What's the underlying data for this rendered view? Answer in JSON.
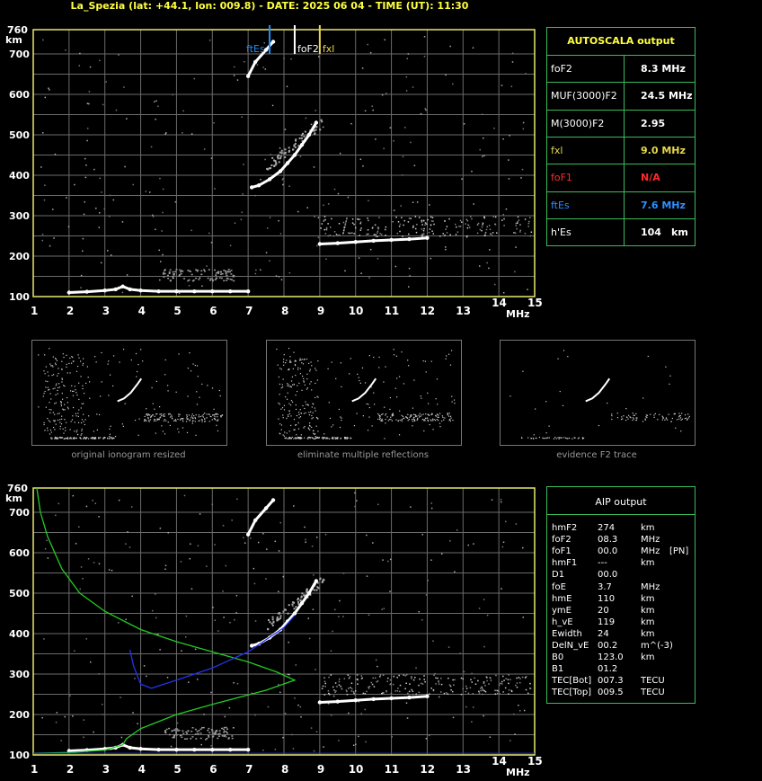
{
  "header": {
    "title": "La_Spezia (lat: +44.1, lon: 009.8) - DATE: 2025 06 04 - TIME (UT): 11:30"
  },
  "axis": {
    "y_unit": "km",
    "x_unit": "MHz",
    "y_top_label": "760",
    "y_ticks": [
      "700",
      "600",
      "500",
      "400",
      "300",
      "200",
      "100"
    ],
    "x_ticks": [
      "1",
      "2",
      "3",
      "4",
      "5",
      "6",
      "7",
      "8",
      "9",
      "10",
      "11",
      "12",
      "13",
      "14",
      "15"
    ]
  },
  "markers": {
    "ftes": {
      "label": "ftEs",
      "color": "#1e90ff",
      "freq": 7.6
    },
    "fof2": {
      "label": "foF2",
      "color": "#ffffff",
      "freq": 8.3
    },
    "fxl": {
      "label": "fxl",
      "color": "#e8d84a",
      "freq": 9.0
    }
  },
  "autoscala": {
    "title": "AUTOSCALA output",
    "rows": [
      {
        "key": "foF2",
        "value": "8.3 MHz",
        "color": "#ffffff"
      },
      {
        "key": "MUF(3000)F2",
        "value": "24.5 MHz",
        "color": "#ffffff"
      },
      {
        "key": "M(3000)F2",
        "value": "2.95",
        "color": "#ffffff"
      },
      {
        "key": "fxl",
        "value": "9.0 MHz",
        "color": "#e8d84a"
      },
      {
        "key": "foF1",
        "value": "N/A",
        "color": "#ff2a2a"
      },
      {
        "key": "ftEs",
        "value": "7.6 MHz",
        "color": "#2f8fff"
      },
      {
        "key": "h'Es",
        "value": "104",
        "unit": "km",
        "color": "#ffffff"
      }
    ]
  },
  "thumbnails": {
    "captions": [
      "original ionogram resized",
      "eliminate multiple reflections",
      "evidence F2 trace"
    ]
  },
  "aip": {
    "title": "AIP output",
    "rows": [
      {
        "k": "hmF2",
        "v": "274",
        "u": "km"
      },
      {
        "k": "foF2",
        "v": "08.3",
        "u": "MHz"
      },
      {
        "k": "foF1",
        "v": "00.0",
        "u": "MHz",
        "x": "[PN]"
      },
      {
        "k": "hmF1",
        "v": "---",
        "u": "km"
      },
      {
        "k": "D1",
        "v": "00.0",
        "u": ""
      },
      {
        "k": "foE",
        "v": "3.7",
        "u": "MHz"
      },
      {
        "k": "hmE",
        "v": "110",
        "u": "km"
      },
      {
        "k": "ymE",
        "v": "20",
        "u": "km"
      },
      {
        "k": "h_vE",
        "v": "119",
        "u": "km"
      },
      {
        "k": "Ewidth",
        "v": "24",
        "u": "km"
      },
      {
        "k": "DelN_vE",
        "v": "00.2",
        "u": "m^(-3)"
      },
      {
        "k": "B0",
        "v": "123.0",
        "u": "km"
      },
      {
        "k": "B1",
        "v": "01.2",
        "u": ""
      },
      {
        "k": "TEC[Bot]",
        "v": "007.3",
        "u": "TECU"
      },
      {
        "k": "TEC[Top]",
        "v": "009.5",
        "u": "TECU"
      }
    ]
  },
  "colors": {
    "grid": "#6b6b6b",
    "frame": "#e8e870",
    "table_border": "#3cbb5a",
    "title": "#ffff40"
  },
  "chart_data": [
    {
      "type": "scatter",
      "xlabel": "MHz",
      "ylabel": "km",
      "xlim": [
        1,
        15
      ],
      "ylim": [
        100,
        760
      ],
      "grid": true,
      "series": [
        {
          "name": "",
          "points": [
            [
              2.0,
              110
            ],
            [
              2.5,
              112
            ],
            [
              3.0,
              115
            ],
            [
              3.3,
              118
            ],
            [
              3.5,
              125
            ],
            [
              3.7,
              118
            ],
            [
              4.0,
              115
            ],
            [
              4.5,
              113
            ],
            [
              5.0,
              113
            ],
            [
              5.5,
              113
            ],
            [
              6.0,
              113
            ],
            [
              6.5,
              113
            ],
            [
              7.0,
              113
            ]
          ]
        },
        {
          "name": "",
          "points": [
            [
              7.1,
              370
            ],
            [
              7.3,
              375
            ],
            [
              7.6,
              390
            ],
            [
              7.9,
              410
            ],
            [
              8.1,
              430
            ],
            [
              8.3,
              450
            ],
            [
              8.5,
              475
            ],
            [
              8.7,
              500
            ],
            [
              8.9,
              530
            ]
          ]
        },
        {
          "name": "",
          "points": [
            [
              9.0,
              230
            ],
            [
              9.5,
              232
            ],
            [
              10.0,
              235
            ],
            [
              10.5,
              238
            ],
            [
              11.0,
              240
            ],
            [
              11.5,
              242
            ],
            [
              12.0,
              245
            ]
          ]
        },
        {
          "name": "",
          "points": [
            [
              7.0,
              645
            ],
            [
              7.2,
              680
            ],
            [
              7.5,
              710
            ],
            [
              7.7,
              730
            ]
          ]
        }
      ]
    },
    {
      "type": "line",
      "xlabel": "MHz",
      "ylabel": "km",
      "xlim": [
        1,
        15
      ],
      "ylim": [
        100,
        760
      ],
      "grid": true,
      "series": [
        {
          "name": "",
          "color": "#22cc22",
          "points": [
            [
              1.1,
              760
            ],
            [
              1.2,
              700
            ],
            [
              1.4,
              640
            ],
            [
              1.8,
              560
            ],
            [
              2.3,
              500
            ],
            [
              3.0,
              455
            ],
            [
              4.0,
              410
            ],
            [
              5.0,
              380
            ],
            [
              6.0,
              355
            ],
            [
              7.0,
              330
            ],
            [
              7.8,
              305
            ],
            [
              8.3,
              285
            ],
            [
              7.5,
              260
            ],
            [
              6.0,
              225
            ],
            [
              5.0,
              200
            ],
            [
              4.0,
              165
            ],
            [
              3.6,
              140
            ],
            [
              3.5,
              125
            ],
            [
              3.0,
              112
            ],
            [
              2.0,
              106
            ],
            [
              1.0,
              104
            ]
          ]
        },
        {
          "name": "",
          "color": "#2233ee",
          "points": [
            [
              3.7,
              360
            ],
            [
              3.8,
              320
            ],
            [
              4.0,
              275
            ],
            [
              4.3,
              265
            ],
            [
              5.0,
              285
            ],
            [
              6.0,
              315
            ],
            [
              7.0,
              355
            ],
            [
              7.5,
              385
            ],
            [
              8.0,
              415
            ],
            [
              8.3,
              445
            ]
          ]
        }
      ]
    }
  ]
}
